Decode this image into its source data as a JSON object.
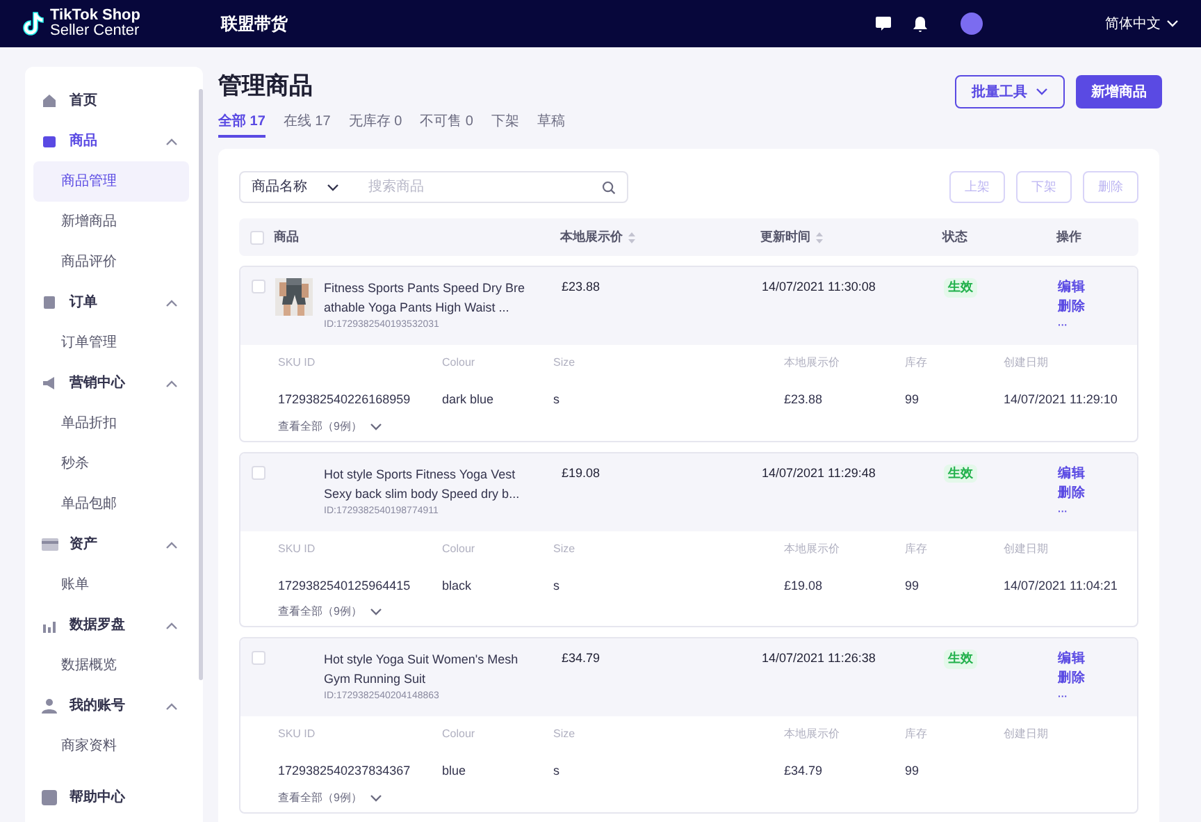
{
  "header": {
    "logo_line1": "TikTok Shop",
    "logo_line2": "Seller Center",
    "app_title": "联盟带货",
    "language": "简体中文"
  },
  "sidebar": {
    "items": [
      {
        "kind": "section",
        "label": "首页",
        "expanded": false,
        "selected": false
      },
      {
        "kind": "section",
        "label": "商品",
        "expanded": true,
        "selected": true
      },
      {
        "kind": "sub",
        "label": "商品管理",
        "selected": true
      },
      {
        "kind": "sub",
        "label": "新增商品",
        "selected": false
      },
      {
        "kind": "sub",
        "label": "商品评价",
        "selected": false
      },
      {
        "kind": "section",
        "label": "订单",
        "expanded": true,
        "selected": false
      },
      {
        "kind": "sub",
        "label": "订单管理",
        "selected": false
      },
      {
        "kind": "section",
        "label": "营销中心",
        "expanded": true,
        "selected": false
      },
      {
        "kind": "sub",
        "label": "单品折扣",
        "selected": false
      },
      {
        "kind": "sub",
        "label": "秒杀",
        "selected": false
      },
      {
        "kind": "sub",
        "label": "单品包邮",
        "selected": false
      },
      {
        "kind": "section",
        "label": "资产",
        "expanded": true,
        "selected": false
      },
      {
        "kind": "sub",
        "label": "账单",
        "selected": false
      },
      {
        "kind": "section",
        "label": "数据罗盘",
        "expanded": true,
        "selected": false
      },
      {
        "kind": "sub",
        "label": "数据概览",
        "selected": false
      },
      {
        "kind": "section",
        "label": "我的账号",
        "expanded": true,
        "selected": false
      },
      {
        "kind": "sub",
        "label": "商家资料",
        "selected": false
      },
      {
        "kind": "section",
        "label": "帮助中心",
        "expanded": false,
        "selected": false
      }
    ]
  },
  "page_title": "管理商品",
  "toolbar_buttons": [
    {
      "label": "批量工具",
      "kind": "outline"
    },
    {
      "label": "新增商品",
      "kind": "primary"
    }
  ],
  "tabs": [
    {
      "label": "全部 17",
      "selected": true
    },
    {
      "label": "在线 17",
      "selected": false
    },
    {
      "label": "无库存 0",
      "selected": false
    },
    {
      "label": "不可售 0",
      "selected": false
    },
    {
      "label": "下架",
      "selected": false
    },
    {
      "label": "草稿",
      "selected": false
    }
  ],
  "search": {
    "filter": "商品名称",
    "placeholder": "搜索商品"
  },
  "bulk_actions": [
    {
      "label": "上架",
      "disabled": true
    },
    {
      "label": "下架",
      "disabled": true
    },
    {
      "label": "删除",
      "disabled": true
    }
  ],
  "table": {
    "select_all_checked": false,
    "columns": [
      "商品",
      "本地展示价",
      "更新时间",
      "状态",
      "操作"
    ],
    "rows": [
      {
        "checked": false,
        "name": "Fitness Sports Pants Speed Dry Breathable Yoga Pants High Waist ...",
        "id": "ID:1729382540193532031",
        "price": "£23.88",
        "updated": "14/07/2021 11:30:08",
        "status": "生效",
        "actions": [
          "编辑",
          "删除",
          "···"
        ],
        "sku_columns": [
          "SKU ID",
          "Colour",
          "Size",
          "本地展示价",
          "库存",
          "创建日期"
        ],
        "sku": [
          "1729382540226168959",
          "dark blue",
          "s",
          "£23.88",
          "99",
          "14/07/2021 11:29:10"
        ],
        "view_all": "查看全部（9例）"
      },
      {
        "checked": false,
        "name": "Hot style Sports Fitness Yoga Vest Sexy back slim body Speed dry b...",
        "id": "ID:1729382540198774911",
        "price": "£19.08",
        "updated": "14/07/2021 11:29:48",
        "status": "生效",
        "actions": [
          "编辑",
          "删除",
          "···"
        ],
        "sku_columns": [
          "SKU ID",
          "Colour",
          "Size",
          "本地展示价",
          "库存",
          "创建日期"
        ],
        "sku": [
          "1729382540125964415",
          "black",
          "s",
          "£19.08",
          "99",
          "14/07/2021 11:04:21"
        ],
        "view_all": "查看全部（9例）"
      },
      {
        "checked": false,
        "name": "Hot style Yoga Suit Women's Mesh Gym Running Suit",
        "id": "ID:1729382540204148863",
        "price": "£34.79",
        "updated": "14/07/2021 11:26:38",
        "status": "生效",
        "actions": [
          "编辑",
          "删除",
          "···"
        ],
        "sku_columns": [
          "SKU ID",
          "Colour",
          "Size",
          "本地展示价",
          "库存",
          "创建日期"
        ],
        "sku": [
          "1729382540237834367",
          "blue",
          "s",
          "£34.79",
          "99"
        ],
        "view_all": "查看全部（9例）"
      }
    ]
  }
}
